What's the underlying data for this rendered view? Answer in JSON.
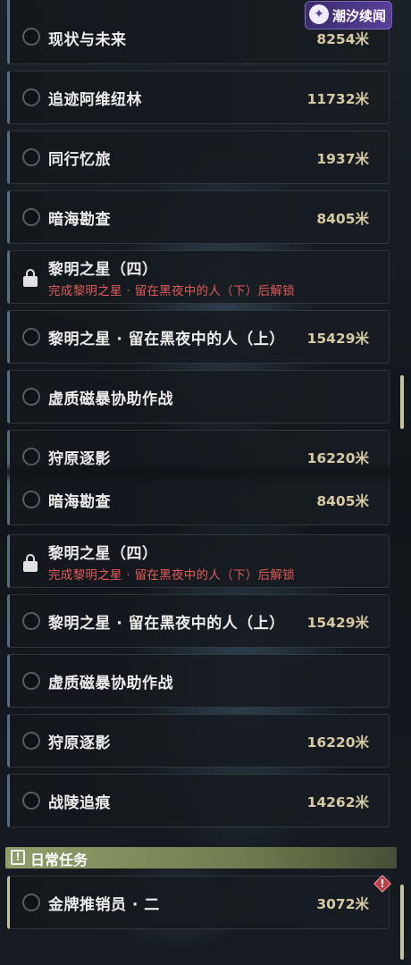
{
  "watermark": {
    "text": "潮汐续闻",
    "logo_glyph": "✦"
  },
  "top_panel": {
    "quests": [
      {
        "name": "现状与未来",
        "distance": "8254米",
        "locked": false
      },
      {
        "name": "追迹阿维纽林",
        "distance": "11732米",
        "locked": false
      },
      {
        "name": "同行忆旅",
        "distance": "1937米",
        "locked": false
      },
      {
        "name": "暗海勘查",
        "distance": "8405米",
        "locked": false
      },
      {
        "name": "黎明之星（四）",
        "subtitle": "完成黎明之星 · 留在黑夜中的人（下）后解锁",
        "locked": true
      },
      {
        "name": "黎明之星 · 留在黑夜中的人（上）",
        "distance": "15429米",
        "locked": false
      },
      {
        "name": "虚质磁暴协助作战",
        "locked": false
      },
      {
        "name": "狩原逐影",
        "distance": "16220米",
        "locked": false
      }
    ]
  },
  "bottom_panel": {
    "quests": [
      {
        "name": "暗海勘查",
        "distance": "8405米",
        "locked": false
      },
      {
        "name": "黎明之星（四）",
        "subtitle": "完成黎明之星 · 留在黑夜中的人（下）后解锁",
        "locked": true
      },
      {
        "name": "黎明之星 · 留在黑夜中的人（上）",
        "distance": "15429米",
        "locked": false
      },
      {
        "name": "虚质磁暴协助作战",
        "locked": false
      },
      {
        "name": "狩原逐影",
        "distance": "16220米",
        "locked": false
      },
      {
        "name": "战陵追痕",
        "distance": "14262米",
        "locked": false
      }
    ],
    "daily_section": {
      "title": "日常任务",
      "icon_glyph": "!",
      "quests": [
        {
          "name": "金牌推销员 · 二",
          "distance": "3072米",
          "locked": false,
          "alert_glyph": "!"
        }
      ]
    }
  },
  "colors": {
    "distance": "#d6c9a4",
    "locked_hint": "#e05a58",
    "section_header": "#8f9e6a",
    "scrollbar": "#c8c49a",
    "alert": "#c13a45",
    "watermark": "#5a3f9a"
  }
}
